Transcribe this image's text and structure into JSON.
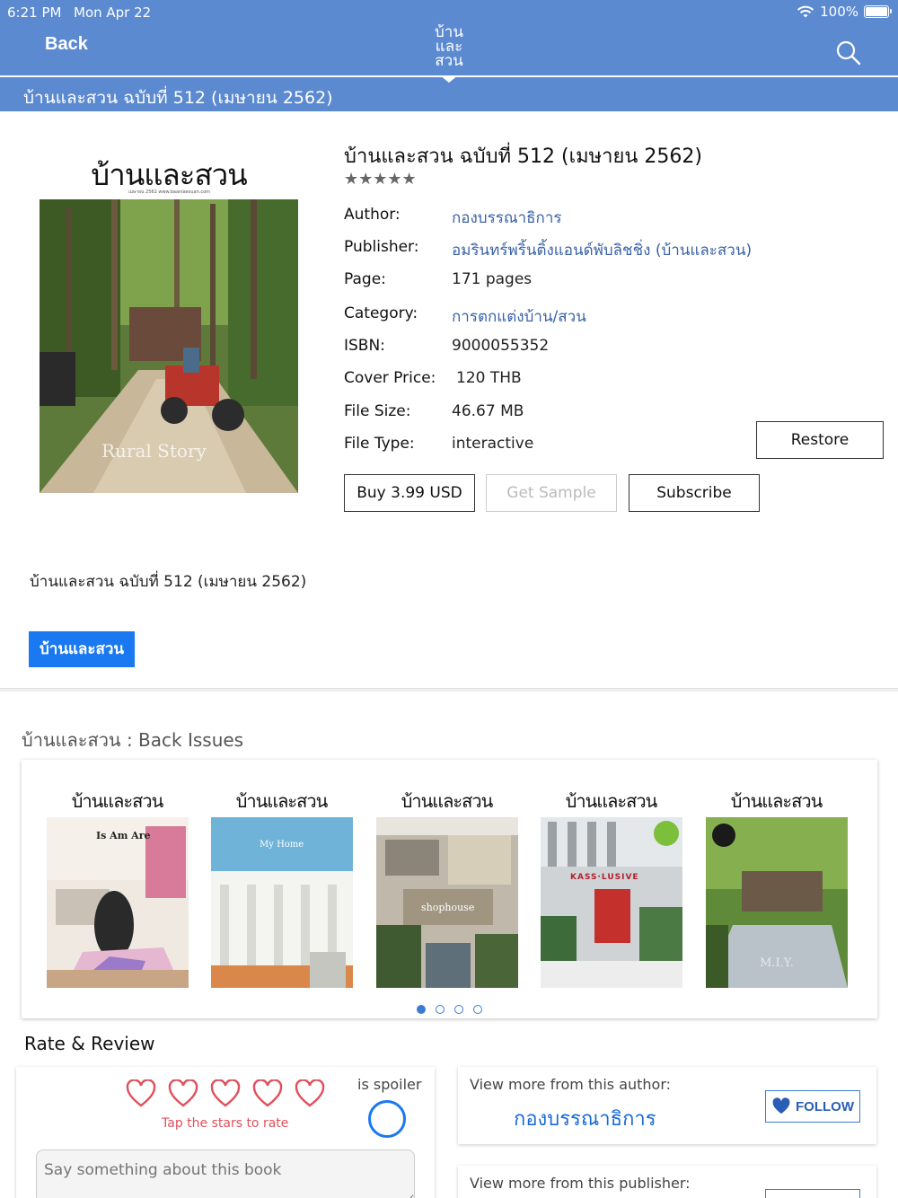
{
  "status_bar": {
    "time": "6:21 PM",
    "date": "Mon Apr 22",
    "battery": "100%"
  },
  "nav": {
    "back_label": "Back",
    "logo_line1": "บ้าน",
    "logo_line2": "และ",
    "logo_line3": "สวน"
  },
  "title_bar": {
    "text": "บ้านและสวน ฉบับที่ 512 (เมษายน 2562)"
  },
  "cover": {
    "masthead": "บ้านและสวน",
    "subline": "เมษายน 2562      www.baanlaesuan.com",
    "caption": "Rural Story"
  },
  "book": {
    "title": "บ้านและสวน ฉบับที่ 512 (เมษายน 2562)",
    "stars": "★★★★★",
    "author_label": "Author:",
    "author": "กองบรรณาธิการ",
    "publisher_label": "Publisher:",
    "publisher": "อมรินทร์พริ้นติ้งแอนด์พับลิชชิ่ง (บ้านและสวน)",
    "page_label": "Page:",
    "pages": "171 pages",
    "category_label": "Category:",
    "category": "การตกแต่งบ้าน/สวน",
    "isbn_label": "ISBN:",
    "isbn": "9000055352",
    "price_label": "Cover Price:",
    "price": "120 THB",
    "filesize_label": "File Size:",
    "filesize": "46.67 MB",
    "filetype_label": "File Type:",
    "filetype": "interactive"
  },
  "actions": {
    "restore": "Restore",
    "buy": "Buy 3.99 USD",
    "sample": "Get Sample",
    "subscribe": "Subscribe"
  },
  "description": "บ้านและสวน ฉบับที่ 512 (เมษายน 2562)",
  "tag": "บ้านและสวน",
  "back_issues": {
    "title": "บ้านและสวน : Back Issues",
    "issues": [
      {
        "masthead": "บ้านและสวน",
        "cover_text": "Is Am Are"
      },
      {
        "masthead": "บ้านและสวน",
        "cover_text": "My Home"
      },
      {
        "masthead": "บ้านและสวน",
        "cover_text": "shophouse"
      },
      {
        "masthead": "บ้านและสวน",
        "cover_text": "KASS·LUSIVE"
      },
      {
        "masthead": "บ้านและสวน",
        "cover_text": "M.I.Y."
      }
    ],
    "pages": 4,
    "current_page": 1
  },
  "rate_review": {
    "title": "Rate & Review",
    "tap_hint": "Tap the stars to rate",
    "spoiler_label": "is spoiler",
    "review_placeholder": "Say something about this book",
    "author_more": "View more from this author:",
    "author_name": "กองบรรณาธิการ",
    "follow": "FOLLOW",
    "publisher_more": "View more from this publisher:"
  },
  "colors": {
    "nav": "#5b8ad1",
    "link": "#3a62a8",
    "tag": "#1a78f0",
    "heart": "#e0505a"
  }
}
